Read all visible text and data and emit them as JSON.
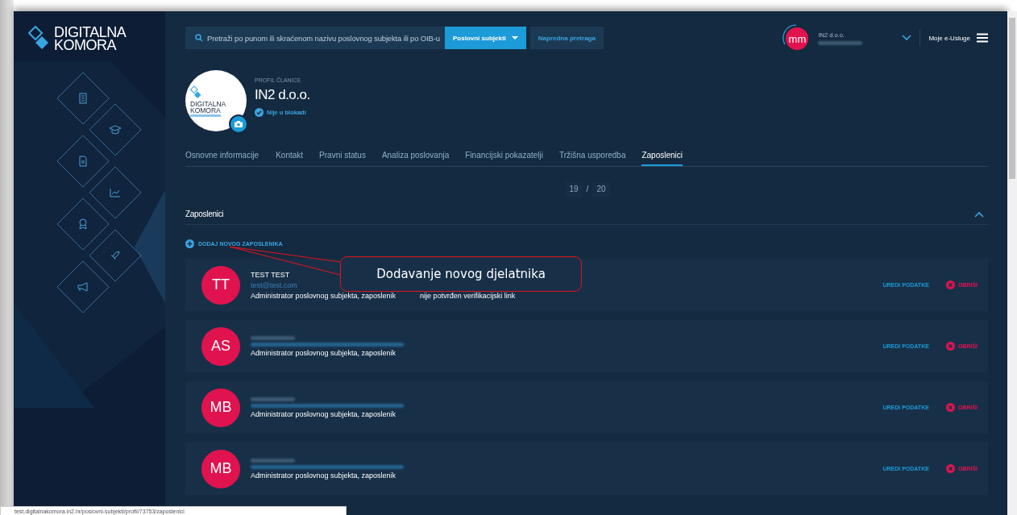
{
  "sidebar": {
    "logo_line_1": "DIGITALNA",
    "logo_line_2": "KOMORA"
  },
  "search": {
    "placeholder": "Pretraži po punom ili skraćenom nazivu poslovnog subjekta ili po OIB-u"
  },
  "header_buttons": [
    {
      "label": "Poslovni subjekti",
      "kind": "dropdown"
    },
    {
      "label": "Napredna pretraga",
      "kind": "plain"
    }
  ],
  "user": {
    "initials": "mm",
    "company": "IN2 d.o.o.",
    "name_blurred": true
  },
  "services": {
    "label": "Moje e-Usluge"
  },
  "profile": {
    "logo_line_1": "DIGITALNA",
    "logo_line_2": "KOMORA",
    "caption": "PROFIL ČLANICE",
    "name": "IN2 d.o.o.",
    "status": "Nije u blokadi"
  },
  "tabs": [
    {
      "label": "Osnovne informacije",
      "selected": false
    },
    {
      "label": "Kontakt",
      "selected": false
    },
    {
      "label": "Pravni status",
      "selected": false
    },
    {
      "label": "Analiza poslovanja",
      "selected": false
    },
    {
      "label": "Financijski pokazatelji",
      "selected": false
    },
    {
      "label": "Tržišna usporedba",
      "selected": false
    },
    {
      "label": "Zaposlenici",
      "selected": true
    }
  ],
  "pager": {
    "current": "19",
    "separator": "/",
    "total": "20"
  },
  "section": {
    "title": "Zaposlenici",
    "expanded": true
  },
  "add_link": {
    "label": "DODAJ NOVOG ZAPOSLENIKA"
  },
  "employees": [
    {
      "initials": "TT",
      "redacted": false,
      "name": "TEST TEST",
      "email": "test@test.com",
      "role": "Administrator poslovnog subjekta, zaposlenik",
      "note": "nije potvrđen verifikacijski link",
      "edit": "UREDI PODATKE",
      "delete": "OBRIŠI"
    },
    {
      "initials": "AS",
      "redacted": true,
      "role": "Administrator poslovnog subjekta, zaposlenik",
      "edit": "UREDI PODATKE",
      "delete": "OBRIŠI"
    },
    {
      "initials": "MB",
      "redacted": true,
      "role": "Administrator poslovnog subjekta, zaposlenik",
      "edit": "UREDI PODATKE",
      "delete": "OBRIŠI"
    },
    {
      "initials": "MB",
      "redacted": true,
      "role": "Administrator poslovnog subjekta, zaposlenik",
      "edit": "UREDI PODATKE",
      "delete": "OBRIŠI"
    }
  ],
  "callout": {
    "text": "Dodavanje novog djelatnika"
  },
  "status_bar": {
    "url": "test.digitalnakomora.in2.hr/poslovni-subjekti/profil/73753/zaposlenici"
  }
}
